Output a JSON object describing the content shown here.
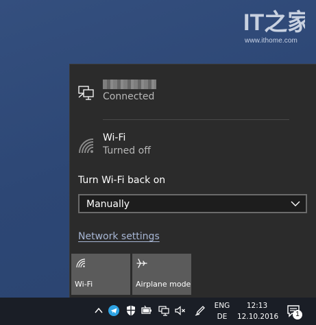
{
  "watermark": {
    "url": "www.ithome.com",
    "logo": "IT之家"
  },
  "network_flyout": {
    "ethernet": {
      "icon": "ethernet-monitor-icon",
      "status": "Connected"
    },
    "wifi": {
      "icon": "wifi-off-icon",
      "title": "Wi-Fi",
      "status": "Turned off"
    },
    "turn_back_on_label": "Turn Wi-Fi back on",
    "turn_back_on_selected": "Manually",
    "network_settings_link": "Network settings",
    "quick_actions": [
      {
        "label": "Wi-Fi",
        "icon": "wifi-icon",
        "active": false
      },
      {
        "label": "Airplane mode",
        "icon": "airplane-icon",
        "active": false
      }
    ]
  },
  "taskbar": {
    "tray_icons": [
      "chevron-up-icon",
      "telegram-icon",
      "shield-icon",
      "battery-icon",
      "network-icon",
      "volume-muted-icon",
      "pen-icon"
    ],
    "language": {
      "line1": "ENG",
      "line2": "DE"
    },
    "clock": {
      "time": "12:13",
      "date": "12.10.2016"
    },
    "notifications": {
      "icon": "action-center-icon",
      "count": "1"
    }
  },
  "colors": {
    "desktop": "#2f4a78",
    "flyout_bg": "#2b2b2b",
    "tile_bg": "#5b5b5b",
    "link": "#a7b6d4",
    "taskbar": "#1a1e26"
  }
}
